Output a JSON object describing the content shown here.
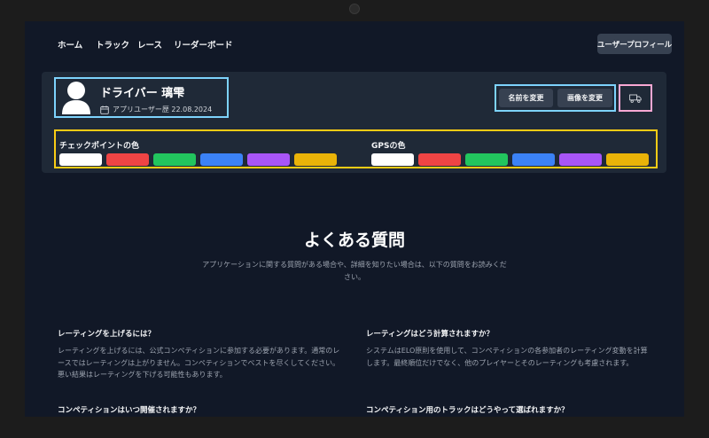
{
  "nav": {
    "links": [
      "ホーム",
      "トラック",
      "レース",
      "リーダーボード"
    ],
    "profile_button": "ユーザープロフィール"
  },
  "profile": {
    "driver_name": "ドライバー 璃雫",
    "since_label": "アプリユーザー歴 22.08.2024",
    "rename_button": "名前を変更",
    "change_image_button": "画像を変更",
    "checkpoint_label": "チェックポイントの色",
    "gps_label": "GPSの色",
    "color_options": [
      "#ffffff",
      "#ef4444",
      "#22c55e",
      "#3b82f6",
      "#a855f7",
      "#eab308"
    ]
  },
  "faq": {
    "title": "よくある質問",
    "subtitle": "アプリケーションに関する質問がある場合や、詳細を知りたい場合は、以下の質問をお読みください。",
    "items": [
      {
        "question": "レーティングを上げるには？",
        "answer": "レーティングを上げるには、公式コンペティションに参加する必要があります。通常のレースではレーティングは上がりません。コンペティションでベストを尽くしてください。悪い結果はレーティングを下げる可能性もあります。"
      },
      {
        "question": "レーティングはどう計算されますか？",
        "answer": "システムはELO原則を使用して、コンペティションの各参加者のレーティング変動を計算します。最終順位だけでなく、他のプレイヤーとそのレーティングも考慮されます。"
      },
      {
        "question": "コンペティションはいつ開催されますか？",
        "answer": ""
      },
      {
        "question": "コンペティション用のトラックはどうやって選ばれますか？",
        "answer": ""
      }
    ]
  }
}
